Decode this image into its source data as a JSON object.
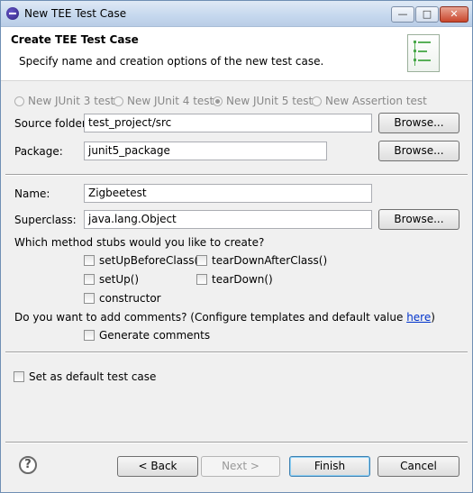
{
  "window": {
    "title": "New TEE Test Case",
    "min_glyph": "—",
    "max_glyph": "□",
    "close_glyph": "✕"
  },
  "header": {
    "title": "Create TEE Test Case",
    "description": "Specify name and creation options of the new test case."
  },
  "radios": [
    {
      "label": "New JUnit 3 test",
      "selected": false
    },
    {
      "label": "New JUnit 4 test",
      "selected": false
    },
    {
      "label": "New JUnit 5 test",
      "selected": true
    },
    {
      "label": "New Assertion test",
      "selected": false
    }
  ],
  "source_folder": {
    "label": "Source folder:",
    "value": "test_project/src",
    "browse": "Browse..."
  },
  "package": {
    "label": "Package:",
    "value": "junit5_package",
    "browse": "Browse..."
  },
  "name": {
    "label": "Name:",
    "value": "Zigbeetest"
  },
  "superclass": {
    "label": "Superclass:",
    "value": "java.lang.Object",
    "browse": "Browse..."
  },
  "stubs": {
    "question": "Which method stubs would you like to create?",
    "setUpBeforeClass": "setUpBeforeClass()",
    "tearDownAfterClass": "tearDownAfterClass()",
    "setUp": "setUp()",
    "tearDown": "tearDown()",
    "constructor": "constructor"
  },
  "comments": {
    "question": "Do you want to add comments? (Configure templates and default value ",
    "link": "here",
    "close_paren": ")",
    "generate": "Generate comments"
  },
  "default_test_case": "Set as default test case",
  "footer": {
    "help": "?",
    "back": "< Back",
    "next": "Next >",
    "finish": "Finish",
    "cancel": "Cancel"
  }
}
